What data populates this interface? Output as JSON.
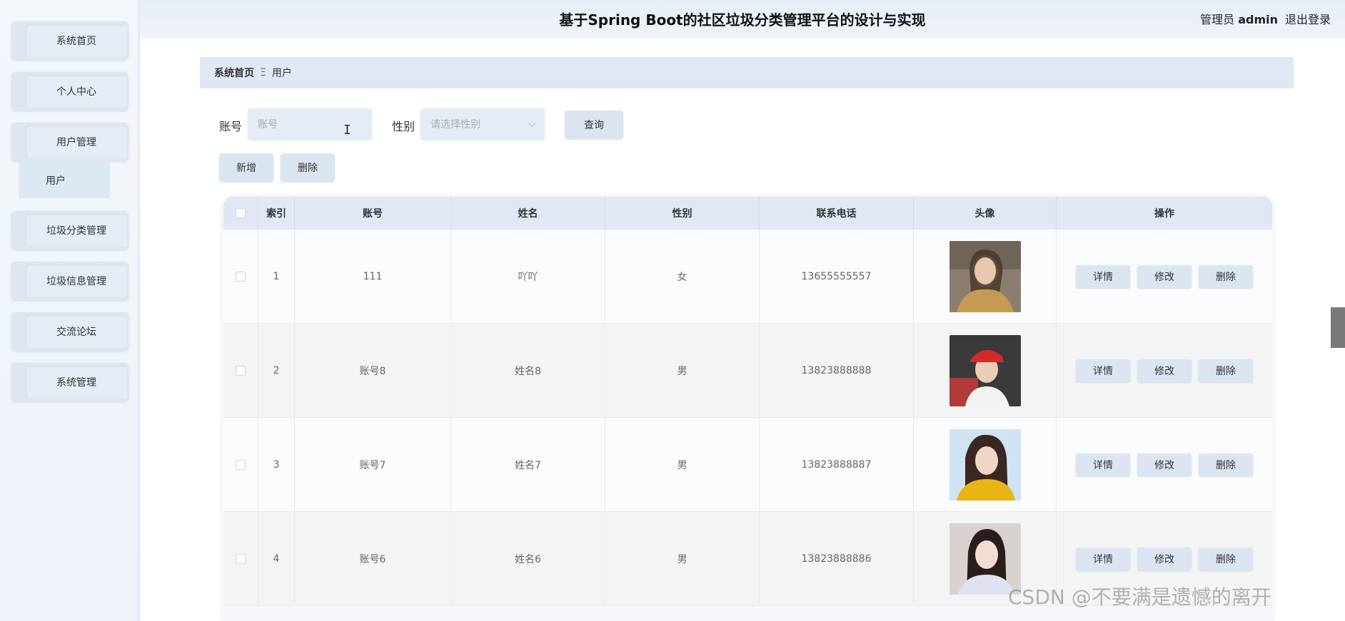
{
  "header": {
    "title": "基于Spring Boot的社区垃圾分类管理平台的设计与实现",
    "role": "管理员",
    "username": "admin",
    "logout": "退出登录"
  },
  "sidebar": {
    "items": [
      {
        "label": "系统首页"
      },
      {
        "label": "个人中心"
      },
      {
        "label": "用户管理"
      },
      {
        "label": "垃圾分类管理"
      },
      {
        "label": "垃圾信息管理"
      },
      {
        "label": "交流论坛"
      },
      {
        "label": "系统管理"
      }
    ],
    "submenu": {
      "label": "用户"
    }
  },
  "breadcrumb": {
    "home": "系统首页",
    "separator": "Ξ",
    "current": "用户"
  },
  "search": {
    "account_label": "账号",
    "account_placeholder": "账号",
    "gender_label": "性别",
    "gender_placeholder": "请选择性别",
    "query_button": "查询"
  },
  "actions": {
    "add": "新增",
    "delete": "删除"
  },
  "table": {
    "columns": [
      "索引",
      "账号",
      "姓名",
      "性别",
      "联系电话",
      "头像",
      "操作"
    ],
    "rows": [
      {
        "index": "1",
        "account": "111",
        "name": "吖吖",
        "gender": "女",
        "phone": "13655555557",
        "avatar_color": "#b89a7c"
      },
      {
        "index": "2",
        "account": "账号8",
        "name": "姓名8",
        "gender": "男",
        "phone": "13823888888",
        "avatar_color": "#c44a4a"
      },
      {
        "index": "3",
        "account": "账号7",
        "name": "姓名7",
        "gender": "男",
        "phone": "13823888887",
        "avatar_color": "#e0b11f"
      },
      {
        "index": "4",
        "account": "账号6",
        "name": "姓名6",
        "gender": "男",
        "phone": "13823888886",
        "avatar_color": "#b7a9a8"
      }
    ],
    "row_actions": {
      "detail": "详情",
      "edit": "修改",
      "delete": "删除"
    }
  },
  "watermark": "CSDN @不要满是遗憾的离开",
  "colors": {
    "accent": "#dbe5f2",
    "header_bg": "#dfe8f4"
  }
}
